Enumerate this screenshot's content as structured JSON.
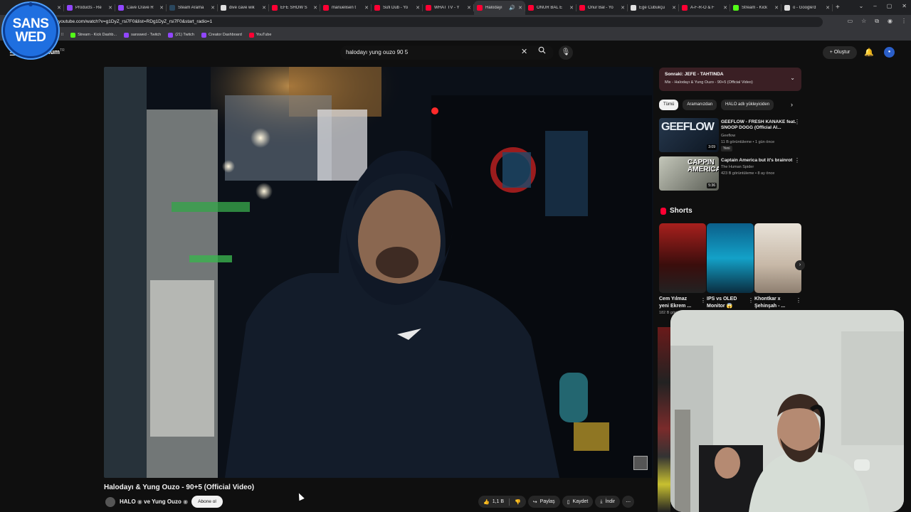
{
  "browser": {
    "tabs": [
      {
        "title": "",
        "color": "#e0e0e0",
        "active": false
      },
      {
        "title": "Products - Re",
        "color": "#9146ff",
        "active": false
      },
      {
        "title": "Cave Crave R",
        "color": "#9146ff",
        "active": false
      },
      {
        "title": "Steam Arama",
        "color": "#2a475e",
        "active": false
      },
      {
        "title": "dive cave wik",
        "color": "#e0e0e0",
        "active": false
      },
      {
        "title": "EFE SHOW S",
        "color": "#ff0033",
        "active": false
      },
      {
        "title": "manuelisen t",
        "color": "#ff0033",
        "active": false
      },
      {
        "title": "Sufi Dub - Yo",
        "color": "#ff0033",
        "active": false
      },
      {
        "title": "WHAT TV - Y",
        "color": "#ff0033",
        "active": false
      },
      {
        "title": "Halodayı",
        "color": "#ff0033",
        "active": true
      },
      {
        "title": "ONUR BAL E",
        "color": "#ff0033",
        "active": false
      },
      {
        "title": "Onur Bal - Yo",
        "color": "#ff0033",
        "active": false
      },
      {
        "title": "Ege Cubukçu",
        "color": "#e0e0e0",
        "active": false
      },
      {
        "title": "A-F-R-O & F",
        "color": "#ff0033",
        "active": false
      },
      {
        "title": "Stream - Kick",
        "color": "#53fc18",
        "active": false
      },
      {
        "title": "o - Google'd",
        "color": "#e0e0e0",
        "active": false
      }
    ],
    "url": "youtube.com/watch?v=g1DyZ_rsi7F0&list=RDg1DyZ_rsi7F0&start_radio=1",
    "bookmarks": [
      {
        "label": "Stream - Kick Dashb...",
        "color": "#53fc18"
      },
      {
        "label": "sanswed - Twitch",
        "color": "#9146ff"
      },
      {
        "label": "(21) Twitch",
        "color": "#9146ff"
      },
      {
        "label": "Creator Dashboard",
        "color": "#9146ff"
      },
      {
        "label": "YouTube",
        "color": "#ff0033"
      }
    ]
  },
  "overlay_logo": {
    "line1": "SANS",
    "line2": "WED"
  },
  "youtube": {
    "logo_text": "mium",
    "logo_region": "TR",
    "search_value": "halodayı yung ouzo 90 5",
    "create_label": "Oluştur"
  },
  "video": {
    "title": "Halodayı & Yung Ouzo - 90+5 (Official Video)",
    "channel": "HALO",
    "channel_joiner": "ve",
    "channel2": "Yung Ouzo",
    "subscribe_label": "Abone ol",
    "likes": "1,1 B",
    "share_label": "Paylaş",
    "save_label": "Kaydet",
    "download_label": "İndir"
  },
  "sidebar": {
    "upnext_title": "Sonraki: JEFE - TAHTINDA",
    "upnext_sub": "Mix - Halodayı & Yung Ouzo - 90+5 (Official Video)",
    "chips": [
      "Tümü",
      "Aramanızdan",
      "HALO adlı yükleyiciden"
    ],
    "recs": [
      {
        "title": "GEEFLOW - FRESH KANAKE feat. SNOOP DOGG (Official AI...",
        "channel": "Geeflow",
        "meta": "11 B görüntüleme • 1 gün önce",
        "badge": "Yeni",
        "duration": "3:09",
        "thumb_text": "GEEFLOW"
      },
      {
        "title": "Captain America but it's brainrot",
        "channel": "The Human Spider",
        "meta": "423 B görüntüleme • 8 ay önce",
        "badge": "",
        "duration": "5:36",
        "thumb_text": "CAPPIN AMERICA"
      }
    ],
    "shorts_heading": "Shorts",
    "shorts": [
      {
        "title": "Cem Yılmaz yeni Ekrem ...",
        "views": "182 B görü"
      },
      {
        "title": "IPS vs OLED Monitor 😱",
        "views": ""
      },
      {
        "title": "Khontkar x Şehinşah - ...",
        "views": ""
      }
    ]
  },
  "colors": {
    "accent": "#ff0033",
    "page_bg": "#0f0f0f",
    "upnext_bg": "#3a1f24"
  }
}
